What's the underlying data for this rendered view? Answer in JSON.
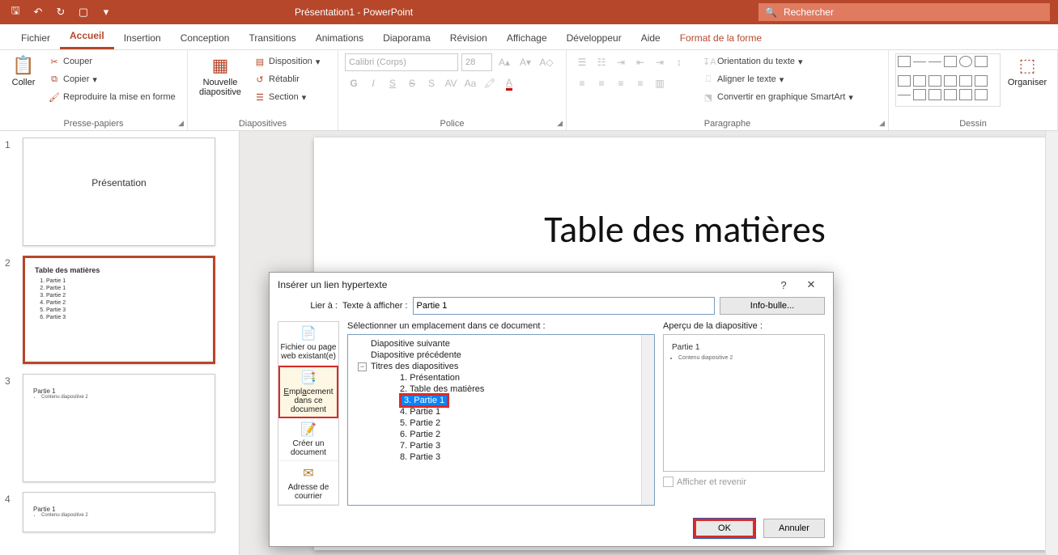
{
  "titlebar": {
    "title": "Présentation1 - PowerPoint",
    "search_placeholder": "Rechercher"
  },
  "tabs": [
    "Fichier",
    "Accueil",
    "Insertion",
    "Conception",
    "Transitions",
    "Animations",
    "Diaporama",
    "Révision",
    "Affichage",
    "Développeur",
    "Aide",
    "Format de la forme"
  ],
  "active_tab": 1,
  "ribbon": {
    "groups": {
      "clipboard": {
        "label": "Presse-papiers",
        "paste": "Coller",
        "cut": "Couper",
        "copy": "Copier",
        "fmtpaint": "Reproduire la mise en forme"
      },
      "slides": {
        "label": "Diapositives",
        "newslide": "Nouvelle diapositive",
        "layout": "Disposition",
        "reset": "Rétablir",
        "section": "Section"
      },
      "font": {
        "label": "Police",
        "fontname": "Calibri (Corps)",
        "fontsize": "28",
        "bold": "G",
        "italic": "I",
        "underline": "S",
        "strike": "S",
        "shadow": "S"
      },
      "paragraph": {
        "label": "Paragraphe",
        "textdir": "Orientation du texte",
        "align": "Aligner le texte",
        "smartart": "Convertir en graphique SmartArt"
      },
      "drawing": {
        "label": "Dessin",
        "organize": "Organiser"
      }
    }
  },
  "thumbnails": [
    {
      "num": "1",
      "title": "Présentation",
      "kind": "title"
    },
    {
      "num": "2",
      "title": "Table des matières",
      "kind": "toc",
      "items": [
        "Partie 1",
        "Partie 1",
        "Partie 2",
        "Partie 2",
        "Partie 3",
        "Partie 3"
      ],
      "selected": true
    },
    {
      "num": "3",
      "title": "Partie 1",
      "kind": "content",
      "body": "Contenu diapositive 2"
    },
    {
      "num": "4",
      "title": "Partie 1",
      "kind": "content",
      "body": "Contenu diapositive 2"
    }
  ],
  "slide": {
    "title": "Table des matières"
  },
  "dialog": {
    "title": "Insérer un lien hypertexte",
    "help": "?",
    "close": "✕",
    "link_to_label": "Lier à :",
    "text_to_display_label": "Texte à afficher :",
    "text_to_display_value": "Partie 1",
    "screentip": "Info-bulle...",
    "linkto_options": [
      {
        "icon": "📄",
        "label": "Fichier ou page web existant(e)"
      },
      {
        "icon": "📑",
        "label": "Emplacement dans ce document",
        "hl": true
      },
      {
        "icon": "📝",
        "label": "Créer un document"
      },
      {
        "icon": "✉",
        "label": "Adresse de courrier"
      }
    ],
    "tree_header": "Sélectionner un emplacement dans ce document :",
    "tree": {
      "next": "Diapositive suivante",
      "prev": "Diapositive précédente",
      "titles": "Titres des diapositives",
      "items": [
        "1. Présentation",
        "2. Table des matières",
        "3. Partie 1",
        "4. Partie 1",
        "5. Partie 2",
        "6. Partie 2",
        "7. Partie 3",
        "8. Partie 3"
      ],
      "selected_index": 2
    },
    "preview_header": "Aperçu de la diapositive :",
    "preview": {
      "title": "Partie 1",
      "body": "Contenu diapositive 2"
    },
    "show_return": "Afficher et revenir",
    "ok": "OK",
    "cancel": "Annuler"
  }
}
